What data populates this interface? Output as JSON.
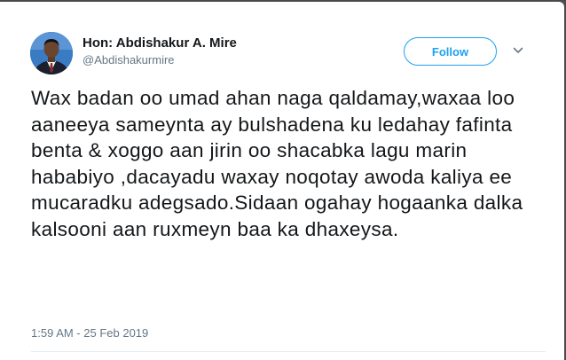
{
  "tweet": {
    "author_name": "Hon: Abdishakur A. Mire",
    "author_handle": "@Abdishakurmire",
    "follow_label": "Follow",
    "text": "Wax badan oo umad ahan naga qaldamay,waxaa loo aaneeya sameynta  ay bulshadena ku ledahay fafinta benta & xoggo aan jirin oo shacabka lagu marin hababiyo ,dacayadu waxay noqotay awoda kaliya ee mucaradku  adegsado.Sidaan ogahay hogaanka dalka kalsooni aan ruxmeyn baa ka dhaxeysa.",
    "timestamp": "1:59 AM - 25 Feb 2019"
  },
  "colors": {
    "accent": "#1da1f2",
    "text": "#14171a",
    "secondary_text": "#657786",
    "frame": "#4a4a4a"
  },
  "icons": {
    "avatar": "user-avatar-photo",
    "menu": "chevron-down-icon"
  }
}
